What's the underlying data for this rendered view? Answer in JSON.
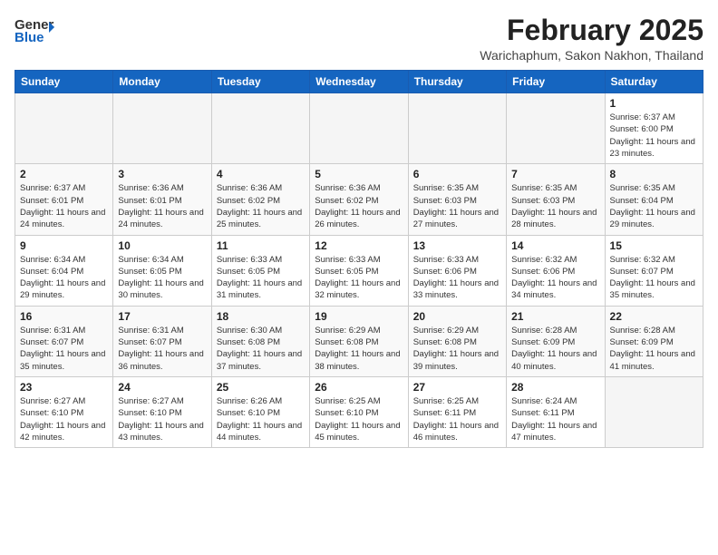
{
  "header": {
    "logo": {
      "line1": "General",
      "line2": "Blue"
    },
    "title": "February 2025",
    "location": "Warichaphum, Sakon Nakhon, Thailand"
  },
  "calendar": {
    "days_of_week": [
      "Sunday",
      "Monday",
      "Tuesday",
      "Wednesday",
      "Thursday",
      "Friday",
      "Saturday"
    ],
    "weeks": [
      [
        {
          "day": "",
          "info": ""
        },
        {
          "day": "",
          "info": ""
        },
        {
          "day": "",
          "info": ""
        },
        {
          "day": "",
          "info": ""
        },
        {
          "day": "",
          "info": ""
        },
        {
          "day": "",
          "info": ""
        },
        {
          "day": "1",
          "info": "Sunrise: 6:37 AM\nSunset: 6:00 PM\nDaylight: 11 hours and 23 minutes."
        }
      ],
      [
        {
          "day": "2",
          "info": "Sunrise: 6:37 AM\nSunset: 6:01 PM\nDaylight: 11 hours and 24 minutes."
        },
        {
          "day": "3",
          "info": "Sunrise: 6:36 AM\nSunset: 6:01 PM\nDaylight: 11 hours and 24 minutes."
        },
        {
          "day": "4",
          "info": "Sunrise: 6:36 AM\nSunset: 6:02 PM\nDaylight: 11 hours and 25 minutes."
        },
        {
          "day": "5",
          "info": "Sunrise: 6:36 AM\nSunset: 6:02 PM\nDaylight: 11 hours and 26 minutes."
        },
        {
          "day": "6",
          "info": "Sunrise: 6:35 AM\nSunset: 6:03 PM\nDaylight: 11 hours and 27 minutes."
        },
        {
          "day": "7",
          "info": "Sunrise: 6:35 AM\nSunset: 6:03 PM\nDaylight: 11 hours and 28 minutes."
        },
        {
          "day": "8",
          "info": "Sunrise: 6:35 AM\nSunset: 6:04 PM\nDaylight: 11 hours and 29 minutes."
        }
      ],
      [
        {
          "day": "9",
          "info": "Sunrise: 6:34 AM\nSunset: 6:04 PM\nDaylight: 11 hours and 29 minutes."
        },
        {
          "day": "10",
          "info": "Sunrise: 6:34 AM\nSunset: 6:05 PM\nDaylight: 11 hours and 30 minutes."
        },
        {
          "day": "11",
          "info": "Sunrise: 6:33 AM\nSunset: 6:05 PM\nDaylight: 11 hours and 31 minutes."
        },
        {
          "day": "12",
          "info": "Sunrise: 6:33 AM\nSunset: 6:05 PM\nDaylight: 11 hours and 32 minutes."
        },
        {
          "day": "13",
          "info": "Sunrise: 6:33 AM\nSunset: 6:06 PM\nDaylight: 11 hours and 33 minutes."
        },
        {
          "day": "14",
          "info": "Sunrise: 6:32 AM\nSunset: 6:06 PM\nDaylight: 11 hours and 34 minutes."
        },
        {
          "day": "15",
          "info": "Sunrise: 6:32 AM\nSunset: 6:07 PM\nDaylight: 11 hours and 35 minutes."
        }
      ],
      [
        {
          "day": "16",
          "info": "Sunrise: 6:31 AM\nSunset: 6:07 PM\nDaylight: 11 hours and 35 minutes."
        },
        {
          "day": "17",
          "info": "Sunrise: 6:31 AM\nSunset: 6:07 PM\nDaylight: 11 hours and 36 minutes."
        },
        {
          "day": "18",
          "info": "Sunrise: 6:30 AM\nSunset: 6:08 PM\nDaylight: 11 hours and 37 minutes."
        },
        {
          "day": "19",
          "info": "Sunrise: 6:29 AM\nSunset: 6:08 PM\nDaylight: 11 hours and 38 minutes."
        },
        {
          "day": "20",
          "info": "Sunrise: 6:29 AM\nSunset: 6:08 PM\nDaylight: 11 hours and 39 minutes."
        },
        {
          "day": "21",
          "info": "Sunrise: 6:28 AM\nSunset: 6:09 PM\nDaylight: 11 hours and 40 minutes."
        },
        {
          "day": "22",
          "info": "Sunrise: 6:28 AM\nSunset: 6:09 PM\nDaylight: 11 hours and 41 minutes."
        }
      ],
      [
        {
          "day": "23",
          "info": "Sunrise: 6:27 AM\nSunset: 6:10 PM\nDaylight: 11 hours and 42 minutes."
        },
        {
          "day": "24",
          "info": "Sunrise: 6:27 AM\nSunset: 6:10 PM\nDaylight: 11 hours and 43 minutes."
        },
        {
          "day": "25",
          "info": "Sunrise: 6:26 AM\nSunset: 6:10 PM\nDaylight: 11 hours and 44 minutes."
        },
        {
          "day": "26",
          "info": "Sunrise: 6:25 AM\nSunset: 6:10 PM\nDaylight: 11 hours and 45 minutes."
        },
        {
          "day": "27",
          "info": "Sunrise: 6:25 AM\nSunset: 6:11 PM\nDaylight: 11 hours and 46 minutes."
        },
        {
          "day": "28",
          "info": "Sunrise: 6:24 AM\nSunset: 6:11 PM\nDaylight: 11 hours and 47 minutes."
        },
        {
          "day": "",
          "info": ""
        }
      ]
    ]
  }
}
